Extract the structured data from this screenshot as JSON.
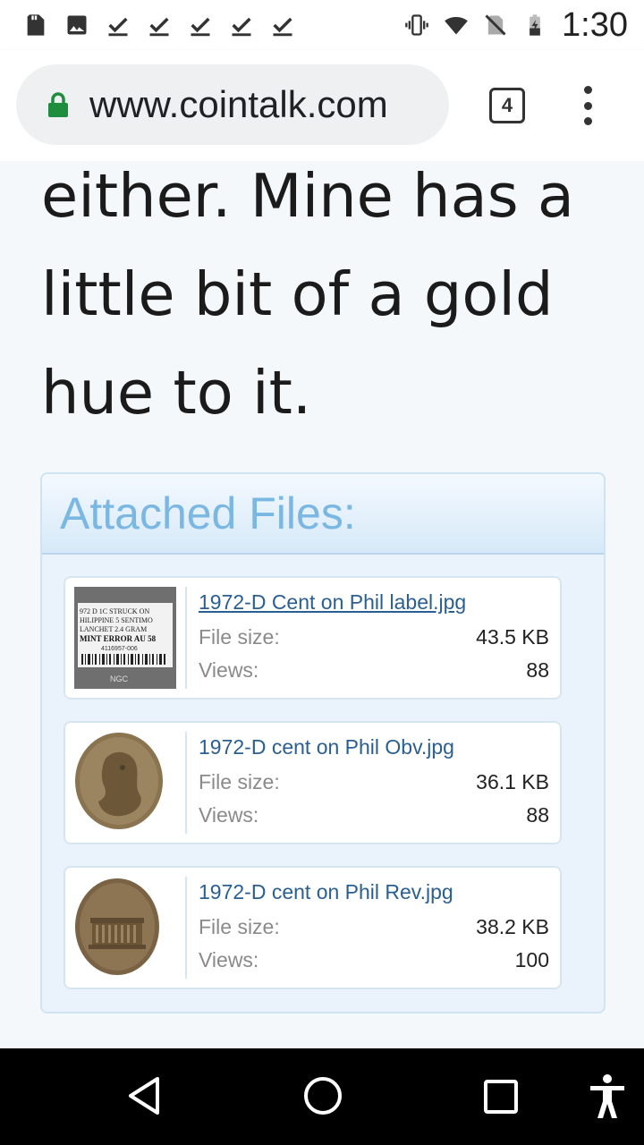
{
  "status_bar": {
    "time": "1:30",
    "left_icons": [
      "sd-card-icon",
      "image-icon",
      "check-icon",
      "check-icon",
      "check-icon",
      "check-icon",
      "check-icon"
    ],
    "right_icons": [
      "vibrate-icon",
      "wifi-icon",
      "no-sim-icon",
      "battery-charging-icon"
    ]
  },
  "browser": {
    "url": "www.cointalk.com",
    "tab_count": "4",
    "secure_icon": "lock-icon",
    "menu_icon": "more-vert-icon"
  },
  "post": {
    "text": "either. Mine has a little bit of a gold hue to it."
  },
  "attachments": {
    "title": "Attached Files:",
    "size_label": "File size:",
    "views_label": "Views:",
    "files": [
      {
        "name": "1972-D Cent on Phil label.jpg",
        "size": "43.5 KB",
        "views": "88",
        "underlined": true
      },
      {
        "name": "1972-D cent on Phil Obv.jpg",
        "size": "36.1 KB",
        "views": "88",
        "underlined": false
      },
      {
        "name": "1972-D cent on Phil Rev.jpg",
        "size": "38.2 KB",
        "views": "100",
        "underlined": false
      }
    ],
    "label_thumb_lines": [
      "972 D 1C STRUCK ON",
      "HILIPPINE 5 SENTIMO",
      "LANCHET 2.4 GRAM",
      "MINT ERROR AU 58",
      "4116957-006",
      "NGC"
    ]
  },
  "nav_bar": {
    "buttons": [
      "back-icon",
      "home-icon",
      "recents-icon",
      "accessibility-icon"
    ]
  },
  "colors": {
    "accent_title": "#7bb7e3",
    "link": "#2a5f93",
    "lock": "#1e8e3e"
  }
}
